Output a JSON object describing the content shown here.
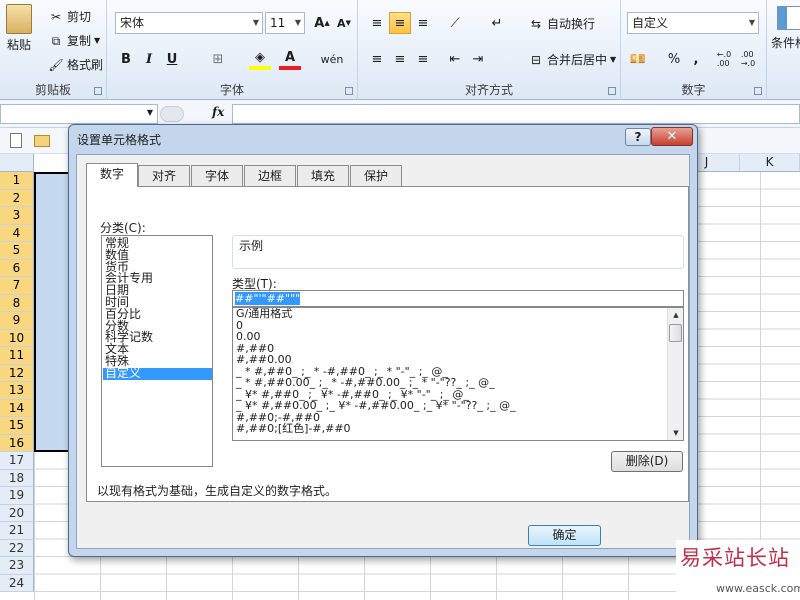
{
  "ribbon": {
    "clipboard": {
      "paste": "粘贴",
      "cut": "剪切",
      "copy": "复制",
      "format_painter": "格式刷",
      "label": "剪贴板"
    },
    "font": {
      "name": "宋体",
      "size": "11",
      "label": "字体",
      "bold": "B",
      "italic": "I",
      "underline": "U"
    },
    "alignment": {
      "wrap_text": "自动换行",
      "merge_center": "合并后居中",
      "label": "对齐方式"
    },
    "number": {
      "format": "自定义",
      "label": "数字",
      "percent": "%",
      "comma": ",",
      "inc_decimal": "←.0\n.00",
      "dec_decimal": ".00\n→.0"
    },
    "conditional": "条件格"
  },
  "formula_bar": {
    "fx": "fx"
  },
  "sheet": {
    "columns": [
      "J",
      "K"
    ],
    "rows": [
      "1",
      "2",
      "3",
      "4",
      "5",
      "6",
      "7",
      "8",
      "9",
      "10",
      "11",
      "12",
      "13",
      "14",
      "15",
      "16",
      "17",
      "18",
      "19",
      "20",
      "21",
      "22",
      "23",
      "24"
    ],
    "selected_rows": 16
  },
  "dialog": {
    "title": "设置单元格格式",
    "help": "?",
    "close": "✕",
    "tabs": [
      "数字",
      "对齐",
      "字体",
      "边框",
      "填充",
      "保护"
    ],
    "category_label": "分类(C):",
    "categories": [
      "常规",
      "数值",
      "货币",
      "会计专用",
      "日期",
      "时间",
      "百分比",
      "分数",
      "科学记数",
      "文本",
      "特殊",
      "自定义"
    ],
    "selected_category": "自定义",
    "sample_label": "示例",
    "type_label": "类型(T):",
    "type_value": "##\"'\"##\"\"\"",
    "formats": [
      "G/通用格式",
      "0",
      "0.00",
      "#,##0",
      "#,##0.00",
      "_ * #,##0_ ;_ * -#,##0_ ;_ * \"-\"_ ;_ @_",
      "_ * #,##0.00_ ;_ * -#,##0.00_ ;_ * \"-\"??_ ;_ @_",
      "_ ¥* #,##0_ ;_ ¥* -#,##0_ ;_ ¥* \"-\"_ ;_ @_",
      "_ ¥* #,##0.00_ ;_ ¥* -#,##0.00_ ;_ ¥* \"-\"??_ ;_ @_",
      "#,##0;-#,##0",
      "#,##0;[红色]-#,##0"
    ],
    "delete_button": "删除(D)",
    "description": "以现有格式为基础，生成自定义的数字格式。",
    "ok_button": "确定"
  },
  "watermark": {
    "title": "易采站长站",
    "url": "www.easck.com"
  }
}
